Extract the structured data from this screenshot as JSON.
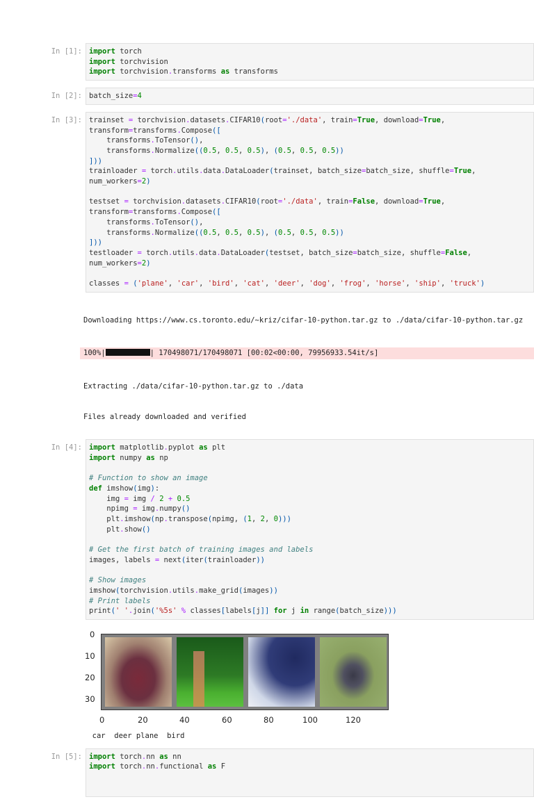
{
  "cells": [
    {
      "prompt": "In [1]:",
      "lines": [
        "import torch",
        "import torchvision",
        "import torchvision.transforms as transforms"
      ]
    },
    {
      "prompt": "In [2]:",
      "lines": [
        "batch_size=4"
      ]
    },
    {
      "prompt": "In [3]:",
      "lines": [
        "trainset = torchvision.datasets.CIFAR10(root='./data', train=True, download=True, transform=transforms.Compose([",
        "    transforms.ToTensor(),",
        "    transforms.Normalize((0.5, 0.5, 0.5), (0.5, 0.5, 0.5))",
        "]))",
        "trainloader = torch.utils.data.DataLoader(trainset, batch_size=batch_size, shuffle=True, num_workers=2)",
        "",
        "testset = torchvision.datasets.CIFAR10(root='./data', train=False, download=True, transform=transforms.Compose([",
        "    transforms.ToTensor(),",
        "    transforms.Normalize((0.5, 0.5, 0.5), (0.5, 0.5, 0.5))",
        "]))",
        "testloader = torch.utils.data.DataLoader(testset, batch_size=batch_size, shuffle=False, num_workers=2)",
        "",
        "classes = ('plane', 'car', 'bird', 'cat', 'deer', 'dog', 'frog', 'horse', 'ship', 'truck')"
      ]
    },
    {
      "prompt": "In [4]:",
      "lines": [
        "import matplotlib.pyplot as plt",
        "import numpy as np",
        "",
        "# Function to show an image",
        "def imshow(img):",
        "    img = img / 2 + 0.5",
        "    npimg = img.numpy()",
        "    plt.imshow(np.transpose(npimg, (1, 2, 0)))",
        "    plt.show()",
        "",
        "# Get the first batch of training images and labels",
        "images, labels = next(iter(trainloader))",
        "",
        "# Show images",
        "imshow(torchvision.utils.make_grid(images))",
        "# Print labels",
        "print(' '.join('%5s' % classes[labels[j]] for j in range(batch_size)))"
      ]
    },
    {
      "prompt": "In [5]:",
      "lines": [
        "import torch.nn as nn",
        "import torch.nn.functional as F"
      ]
    }
  ],
  "output3": {
    "downloading": "Downloading https://www.cs.toronto.edu/~kriz/cifar-10-python.tar.gz to ./data/cifar-10-python.tar.gz",
    "progress_prefix": "100%|",
    "progress_suffix": "| 170498071/170498071 [00:02<00:00, 79956933.54it/s]",
    "progress_percent": 100,
    "extracting": "Extracting ./data/cifar-10-python.tar.gz to ./data",
    "verified": "Files already downloaded and verified"
  },
  "output4": {
    "plot": {
      "yticks": [
        "0",
        "10",
        "20",
        "30"
      ],
      "xticks": [
        "0",
        "20",
        "40",
        "60",
        "80",
        "100",
        "120"
      ],
      "images": [
        "car",
        "deer",
        "plane",
        "bird"
      ]
    },
    "labels_printed": "  car  deer plane  bird"
  }
}
